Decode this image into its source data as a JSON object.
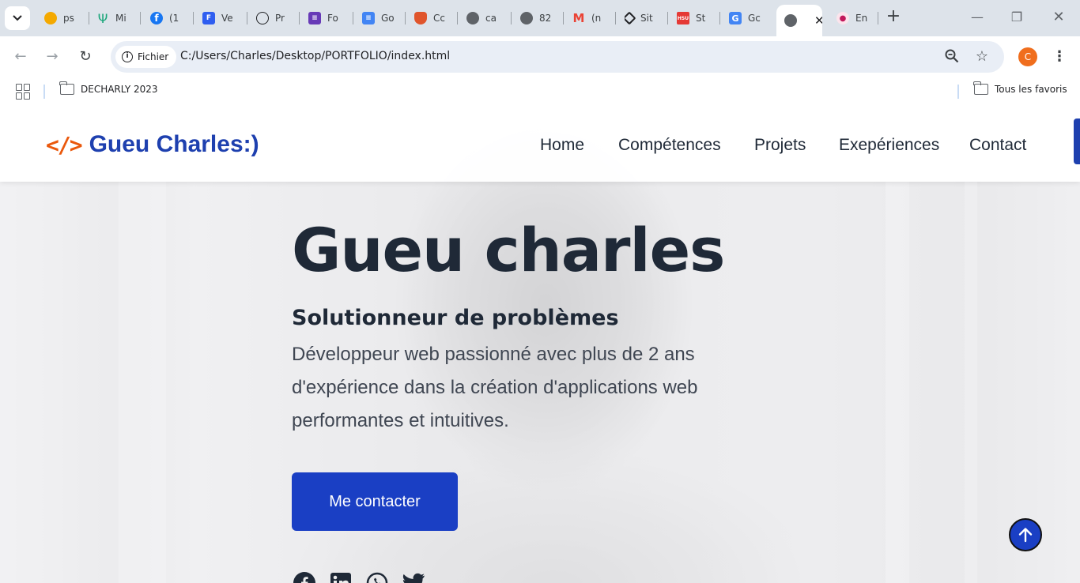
{
  "browser": {
    "tabs": [
      {
        "label": "ps",
        "icon": "orange-half-circle-icon",
        "color": "#f4a900"
      },
      {
        "label": "Mi",
        "icon": "psi-icon",
        "color": "#1aa67a"
      },
      {
        "label": "(1",
        "icon": "facebook-icon",
        "color": "#1877f2"
      },
      {
        "label": "Ve",
        "icon": "forms-app-icon",
        "color": "#2f5ef0"
      },
      {
        "label": "Pr",
        "icon": "openai-icon",
        "color": "#202124"
      },
      {
        "label": "Fo",
        "icon": "google-forms-icon",
        "color": "#673ab7"
      },
      {
        "label": "Go",
        "icon": "google-docs-icon",
        "color": "#4285f4"
      },
      {
        "label": "Cc",
        "icon": "shield-icon",
        "color": "#e0552c"
      },
      {
        "label": "ca",
        "icon": "globe-icon",
        "color": "#5f6368"
      },
      {
        "label": "82",
        "icon": "globe-icon",
        "color": "#5f6368"
      },
      {
        "label": "(n",
        "icon": "gmail-icon",
        "color": "#ea4335"
      },
      {
        "label": "Sit",
        "icon": "codepen-icon",
        "color": "#202124"
      },
      {
        "label": "St",
        "icon": "hsu-icon",
        "color": "#e53935"
      },
      {
        "label": "Gc",
        "icon": "google-translate-icon",
        "color": "#4285f4"
      },
      {
        "label": "",
        "icon": "globe-icon",
        "color": "#5f6368",
        "active": true
      },
      {
        "label": "En",
        "icon": "ribbon-icon",
        "color": "#c2185b"
      }
    ],
    "site_chip": "Fichier",
    "url": "C:/Users/Charles/Desktop/PORTFOLIO/index.html",
    "profile_initial": "C",
    "bookmarks": {
      "left_folder": "DECHARLY 2023",
      "all_bookmarks": "Tous les favoris"
    }
  },
  "site": {
    "logo_code": "</>",
    "logo_text": "Gueu Charles:)",
    "nav": [
      "Home",
      "Compétences",
      "Projets",
      "Exepériences",
      "Contact"
    ],
    "hero": {
      "title": "Gueu charles",
      "subtitle": "Solutionneur de problèmes",
      "description": "Développeur web passionné avec plus de 2 ans d'expérience dans la création d'applications web performantes et intuitives.",
      "cta": "Me contacter"
    },
    "socials": [
      "facebook-icon",
      "linkedin-icon",
      "whatsapp-icon",
      "twitter-icon"
    ],
    "accent_color": "#1a3fc4",
    "logo_color": "#1e40af",
    "logo_code_color": "#ea580c"
  }
}
